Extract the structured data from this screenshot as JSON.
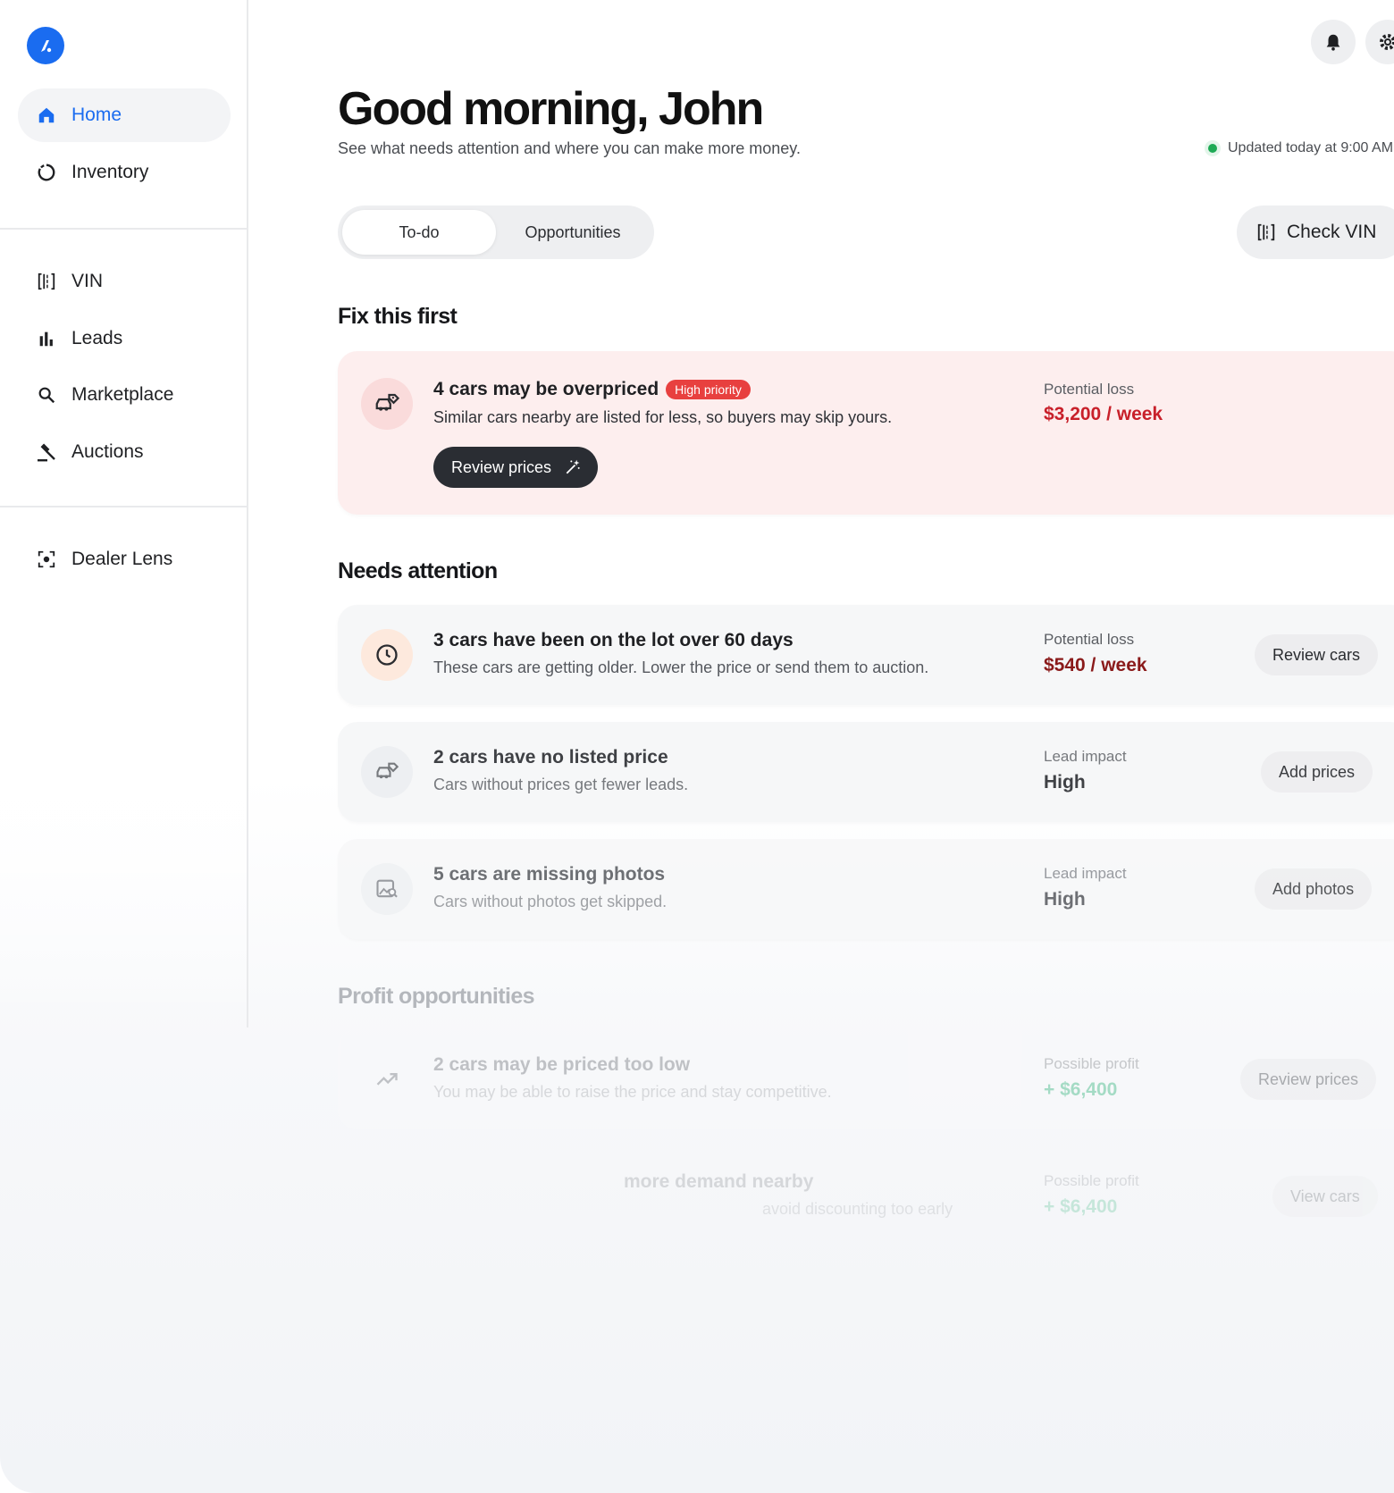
{
  "sidebar": {
    "items": [
      {
        "label": "Home",
        "icon": "home-icon",
        "active": true
      },
      {
        "label": "Inventory",
        "icon": "inventory-icon"
      },
      {
        "label": "VIN",
        "icon": "vin-scan-icon"
      },
      {
        "label": "Leads",
        "icon": "bar-chart-icon"
      },
      {
        "label": "Marketplace",
        "icon": "search-icon"
      },
      {
        "label": "Auctions",
        "icon": "gavel-icon"
      },
      {
        "label": "Dealer Lens",
        "icon": "lens-icon"
      }
    ]
  },
  "header": {
    "greeting": "Good morning, John",
    "subtitle": "See what needs attention and where you can make more money.",
    "updated": "Updated today at 9:00 AM"
  },
  "tabs": [
    {
      "label": "To-do",
      "active": true
    },
    {
      "label": "Opportunities",
      "active": false
    }
  ],
  "check_vin_label": "Check VIN",
  "sections": {
    "fix_first": "Fix this first",
    "needs_attention": "Needs attention",
    "profit": "Profit opportunities"
  },
  "priority_card": {
    "title": "4 cars may be overpriced",
    "badge": "High priority",
    "desc": "Similar cars nearby are listed for less, so buyers may skip yours.",
    "button": "Review prices",
    "metric_label": "Potential loss",
    "metric_value": "$3,200 / week"
  },
  "attention_cards": [
    {
      "title": "3 cars have been on the lot over 60 days",
      "desc": "These cars are getting older. Lower the price or send them to auction.",
      "metric_label": "Potential loss",
      "metric_value": "$540 / week",
      "button": "Review cars"
    },
    {
      "title": "2 cars have no listed price",
      "desc": "Cars without prices get fewer leads.",
      "metric_label": "Lead impact",
      "metric_value": "High",
      "button": "Add prices"
    },
    {
      "title": "5 cars are missing photos",
      "desc": "Cars without photos get skipped.",
      "metric_label": "Lead impact",
      "metric_value": "High",
      "button": "Add photos"
    }
  ],
  "profit_cards": [
    {
      "title": "2 cars may be priced too low",
      "desc": "You may be able to raise the price and stay competitive.",
      "metric_label": "Possible profit",
      "metric_value": "+ $6,400",
      "button": "Review prices"
    },
    {
      "title": "more demand nearby",
      "desc": "avoid discounting too early",
      "metric_label": "Possible profit",
      "metric_value": "+ $6,400",
      "button": "View cars"
    }
  ],
  "colors": {
    "accent": "#1a6cf0",
    "danger": "#c8202a",
    "badge": "#e8403f",
    "profit": "#2bb27a",
    "priority_bg": "#fdeeee"
  }
}
